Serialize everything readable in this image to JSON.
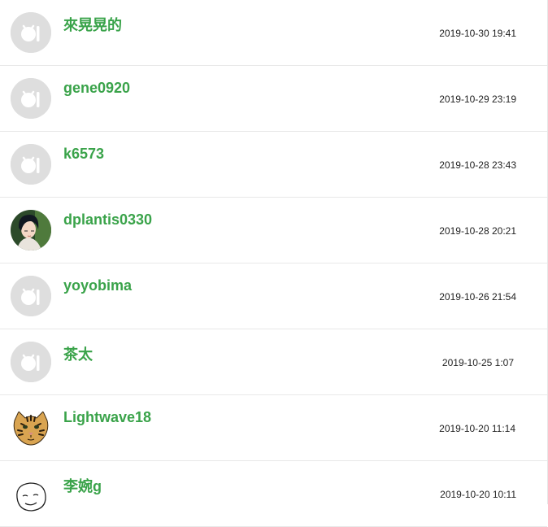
{
  "comments": [
    {
      "username": "來晃晃的",
      "timestamp": "2019-10-30 19:41",
      "avatar": "default-avatar-icon"
    },
    {
      "username": "gene0920",
      "timestamp": "2019-10-29 23:19",
      "avatar": "default-avatar-icon"
    },
    {
      "username": "k6573",
      "timestamp": "2019-10-28 23:43",
      "avatar": "default-avatar-icon"
    },
    {
      "username": "dplantis0330",
      "timestamp": "2019-10-28 20:21",
      "avatar": "anime-portrait-avatar"
    },
    {
      "username": "yoyobima",
      "timestamp": "2019-10-26 21:54",
      "avatar": "default-avatar-icon"
    },
    {
      "username": "茶太",
      "timestamp": "2019-10-25 1:07",
      "avatar": "default-avatar-icon"
    },
    {
      "username": "Lightwave18",
      "timestamp": "2019-10-20 11:14",
      "avatar": "leopard-cat-avatar"
    },
    {
      "username": "李婉g",
      "timestamp": "2019-10-20 10:11",
      "avatar": "smiley-sketch-avatar"
    }
  ],
  "colors": {
    "username": "#3aa34a",
    "timestamp": "#222222",
    "divider": "#e8e8e8",
    "default_avatar_bg": "#dedede"
  }
}
